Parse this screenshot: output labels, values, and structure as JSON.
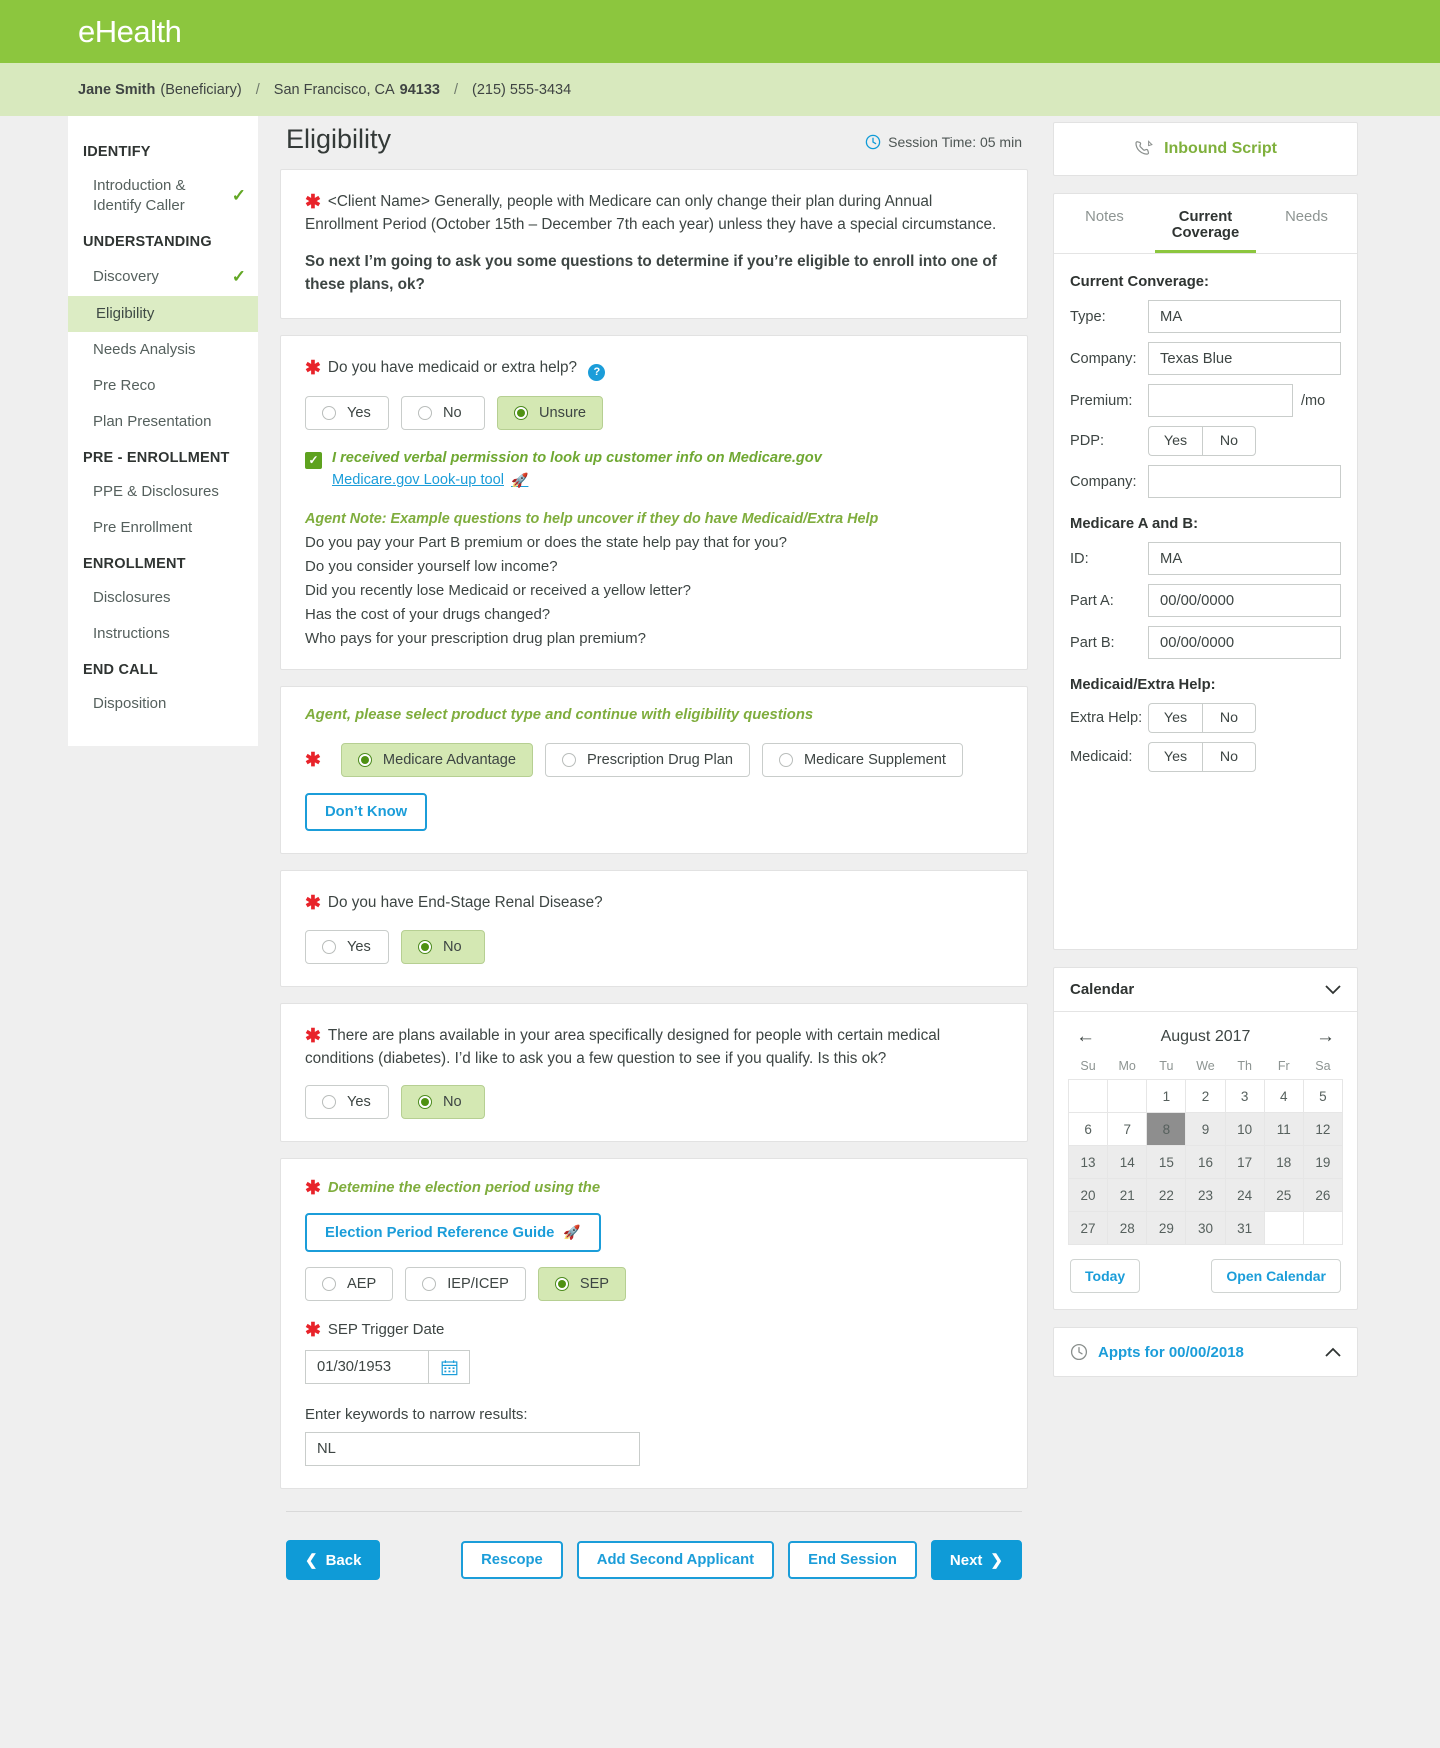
{
  "brand": {
    "logo": "eHealth"
  },
  "customer_bar": {
    "name": "Jane Smith",
    "role": "(Beneficiary)",
    "sep1": "/",
    "city_state": "San Francisco, CA",
    "zip": "94133",
    "sep2": "/",
    "phone": "(215) 555-3434"
  },
  "sidebar": {
    "groups": [
      {
        "title": "IDENTIFY",
        "items": [
          {
            "label": "Introduction & Identify Caller",
            "check": "✓",
            "active": false
          }
        ]
      },
      {
        "title": "UNDERSTANDING",
        "items": [
          {
            "label": "Discovery",
            "check": "✓",
            "active": false
          },
          {
            "label": "Eligibility",
            "check": "",
            "active": true
          },
          {
            "label": "Needs Analysis",
            "check": "",
            "active": false
          },
          {
            "label": "Pre Reco",
            "check": "",
            "active": false
          },
          {
            "label": "Plan Presentation",
            "check": "",
            "active": false
          }
        ]
      },
      {
        "title": "PRE - ENROLLMENT",
        "items": [
          {
            "label": "PPE & Disclosures",
            "check": "",
            "active": false
          },
          {
            "label": "Pre Enrollment",
            "check": "",
            "active": false
          }
        ]
      },
      {
        "title": "ENROLLMENT",
        "items": [
          {
            "label": "Disclosures",
            "check": "",
            "active": false
          },
          {
            "label": "Instructions",
            "check": "",
            "active": false
          }
        ]
      },
      {
        "title": "END CALL",
        "items": [
          {
            "label": "Disposition",
            "check": "",
            "active": false
          }
        ]
      }
    ]
  },
  "main": {
    "page_title": "Eligibility",
    "session_time": "Session Time: 05 min",
    "intro": {
      "paragraph1": "<Client Name> Generally, people with Medicare can only change their plan during Annual Enrollment Period (October 15th – December 7th each year) unless they have a special circumstance.",
      "paragraph2": "So next I’m going to ask you some questions to determine if you’re eligible to enroll into one of these plans, ok?"
    },
    "medicaid": {
      "question": "Do you have medicaid or extra help?",
      "help_icon": "?",
      "options": [
        {
          "label": "Yes",
          "selected": false
        },
        {
          "label": "No",
          "selected": false
        },
        {
          "label": "Unsure",
          "selected": true
        }
      ],
      "permission_text": "I received verbal permission to look up customer info on Medicare.gov",
      "permission_checked": true,
      "lookup_link": "Medicare.gov Look-up tool",
      "agent_note_title": "Agent Note: Example questions to help uncover if they do have Medicaid/Extra Help",
      "agent_note_lines": [
        "Do you pay your Part B premium or does the state help pay that for you?",
        "Do you consider yourself low income?",
        "Did you recently lose Medicaid or received a yellow letter?",
        "Has the cost of your drugs changed?",
        "Who pays for your prescription drug plan premium?"
      ]
    },
    "product": {
      "instruction": "Agent, please select product type and continue with eligibility questions",
      "options": [
        {
          "label": "Medicare Advantage",
          "selected": true
        },
        {
          "label": "Prescription Drug Plan",
          "selected": false
        },
        {
          "label": "Medicare Supplement",
          "selected": false
        }
      ],
      "dont_know_label": "Don’t Know"
    },
    "esrd": {
      "question": "Do you have End-Stage Renal Disease?",
      "options": [
        {
          "label": "Yes",
          "selected": false
        },
        {
          "label": "No",
          "selected": true
        }
      ]
    },
    "snp": {
      "question": "There are plans available in your area specifically designed for people with certain medical conditions (diabetes). I’d like to ask you a few question to see if you qualify. Is this ok?",
      "options": [
        {
          "label": "Yes",
          "selected": false
        },
        {
          "label": "No",
          "selected": true
        }
      ]
    },
    "election": {
      "instruction": "Detemine the election period using the",
      "guide_button": "Election Period Reference Guide",
      "options": [
        {
          "label": "AEP",
          "selected": false
        },
        {
          "label": "IEP/ICEP",
          "selected": false
        },
        {
          "label": "SEP",
          "selected": true
        }
      ],
      "trigger_date_label": "SEP Trigger Date",
      "trigger_date_value": "01/30/1953",
      "keywords_label": "Enter keywords to narrow results:",
      "keywords_value": "NL"
    },
    "footer_buttons": {
      "back": "Back",
      "rescope": "Rescope",
      "add_second_applicant": "Add Second Applicant",
      "end_session": "End Session",
      "next": "Next"
    }
  },
  "rail": {
    "inbound_script": "Inbound Script",
    "tabs": [
      {
        "label": "Notes",
        "active": false
      },
      {
        "label": "Current Coverage",
        "active": true
      },
      {
        "label": "Needs",
        "active": false
      }
    ],
    "current_coverage": {
      "title": "Current Converage:",
      "type_label": "Type:",
      "type_value": "MA",
      "company_label": "Company:",
      "company_value": "Texas Blue",
      "premium_label": "Premium:",
      "premium_value": "",
      "premium_unit": "/mo",
      "pdp_label": "PDP:",
      "pdp_yes": "Yes",
      "pdp_no": "No",
      "pdp_company_label": "Company:",
      "pdp_company_value": ""
    },
    "medicare_ab": {
      "title": "Medicare A and B:",
      "id_label": "ID:",
      "id_value": "MA",
      "part_a_label": "Part A:",
      "part_a_value": "00/00/0000",
      "part_b_label": "Part B:",
      "part_b_value": "00/00/0000"
    },
    "medicaid_extra": {
      "title": "Medicaid/Extra Help:",
      "extra_help_label": "Extra Help:",
      "extra_help_yes": "Yes",
      "extra_help_no": "No",
      "medicaid_label": "Medicaid:",
      "medicaid_yes": "Yes",
      "medicaid_no": "No"
    },
    "calendar": {
      "header": "Calendar",
      "month_year": "August 2017",
      "prev": "←",
      "next": "→",
      "weekdays": [
        "Su",
        "Mo",
        "Tu",
        "We",
        "Th",
        "Fr",
        "Sa"
      ],
      "weeks": [
        [
          {
            "d": "",
            "s": "blank"
          },
          {
            "d": "",
            "s": "blank"
          },
          {
            "d": "1",
            "s": "white"
          },
          {
            "d": "2",
            "s": "white"
          },
          {
            "d": "3",
            "s": "white"
          },
          {
            "d": "4",
            "s": "white"
          },
          {
            "d": "5",
            "s": "white"
          }
        ],
        [
          {
            "d": "6",
            "s": "white"
          },
          {
            "d": "7",
            "s": "white"
          },
          {
            "d": "8",
            "s": "today"
          },
          {
            "d": "9",
            "s": "grey"
          },
          {
            "d": "10",
            "s": "grey"
          },
          {
            "d": "11",
            "s": "grey"
          },
          {
            "d": "12",
            "s": "grey"
          }
        ],
        [
          {
            "d": "13",
            "s": "grey"
          },
          {
            "d": "14",
            "s": "grey"
          },
          {
            "d": "15",
            "s": "grey"
          },
          {
            "d": "16",
            "s": "grey"
          },
          {
            "d": "17",
            "s": "grey"
          },
          {
            "d": "18",
            "s": "grey"
          },
          {
            "d": "19",
            "s": "grey"
          }
        ],
        [
          {
            "d": "20",
            "s": "grey"
          },
          {
            "d": "21",
            "s": "grey"
          },
          {
            "d": "22",
            "s": "grey"
          },
          {
            "d": "23",
            "s": "grey"
          },
          {
            "d": "24",
            "s": "grey"
          },
          {
            "d": "25",
            "s": "grey"
          },
          {
            "d": "26",
            "s": "grey"
          }
        ],
        [
          {
            "d": "27",
            "s": "grey"
          },
          {
            "d": "28",
            "s": "grey"
          },
          {
            "d": "29",
            "s": "grey"
          },
          {
            "d": "30",
            "s": "grey"
          },
          {
            "d": "31",
            "s": "grey"
          },
          {
            "d": "",
            "s": "blank"
          },
          {
            "d": "",
            "s": "blank"
          }
        ]
      ],
      "today_button": "Today",
      "open_button": "Open Calendar"
    },
    "appts": {
      "label": "Appts for 00/00/2018",
      "caret": "⌃"
    }
  },
  "colors": {
    "brand_green": "#8cc63e",
    "brand_green_light": "#d8e9be",
    "selected_green": "#d4e8b3",
    "link_blue": "#1b9dd9",
    "required_red": "#e8232a"
  }
}
